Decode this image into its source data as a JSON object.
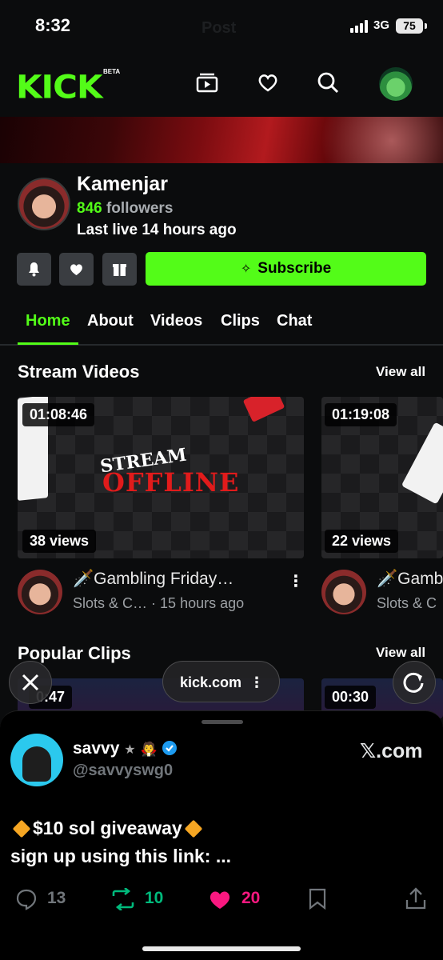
{
  "status_bar": {
    "time": "8:32",
    "network": "3G",
    "battery": "75",
    "ghost_text": "Post"
  },
  "header": {
    "logo": "KICK",
    "logo_badge": "BETA",
    "icons": [
      "browse-icon",
      "heart-icon",
      "search-icon",
      "user-avatar"
    ]
  },
  "profile": {
    "name": "Kamenjar",
    "followers_count": "846",
    "followers_label": "followers",
    "last_live": "Last live 14 hours ago",
    "subscribe_label": "Subscribe"
  },
  "tabs": [
    {
      "label": "Home",
      "active": true
    },
    {
      "label": "About"
    },
    {
      "label": "Videos"
    },
    {
      "label": "Clips"
    },
    {
      "label": "Chat"
    }
  ],
  "stream_videos": {
    "title": "Stream Videos",
    "view_all": "View all",
    "items": [
      {
        "duration": "01:08:46",
        "views": "38 views",
        "title": "🗡️Gambling Friday…",
        "category": "Slots & C…",
        "age": "15 hours ago",
        "overlay_top": "STREAM",
        "overlay_bottom": "OFFLINE"
      },
      {
        "duration": "01:19:08",
        "views": "22 views",
        "title": "🗡️Gamb",
        "category": "Slots & C"
      }
    ]
  },
  "popular_clips": {
    "title": "Popular Clips",
    "view_all": "View all",
    "items": [
      {
        "duration": "00:47",
        "duration_visible": "0:47"
      },
      {
        "duration": "00:30"
      }
    ]
  },
  "browser": {
    "url": "kick.com",
    "menu": "⋮"
  },
  "tweet": {
    "name": "savvy",
    "handle": "@savvyswg0",
    "source": "𝕏.com",
    "line1": "$10 sol giveaway",
    "line2": "sign up using this link: ...",
    "replies": "13",
    "retweets": "10",
    "likes": "20",
    "colors": {
      "retweet": "#00ba7c",
      "like": "#f91880"
    }
  },
  "colors": {
    "accent": "#53fc18",
    "background": "#0b0c0d"
  }
}
